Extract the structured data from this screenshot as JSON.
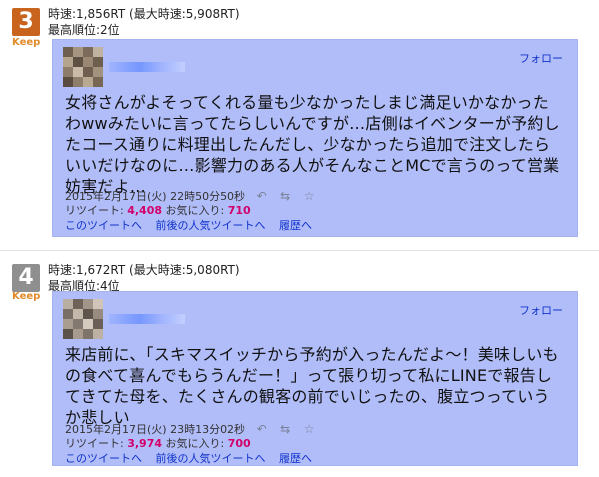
{
  "entries": [
    {
      "rank": "3",
      "keep": "Keep",
      "speed": "時速:1,856RT (最大時速:5,908RT)",
      "highest": "最高順位:2位",
      "follow": "フォロー",
      "text": "女将さんがよそってくれる量も少なかったしまじ満足いかなかったわwwみたいに言ってたらしいんですが…店側はイベンターが予約したコース通りに料理出したんだし、少なかったら追加で注文したらいいだけなのに…影響力のある人がそんなことMCで言うのって営業妨害だよ…",
      "date": "2015年2月17日(火) 22時50分50秒",
      "retweet_label": "リツイート:",
      "retweets": "4,408",
      "fav_label": "お気に入り:",
      "favs": "710",
      "link_tweet": "このツイートへ",
      "link_popular": "前後の人気ツイートへ",
      "link_history": "履歴へ"
    },
    {
      "rank": "4",
      "keep": "Keep",
      "speed": "時速:1,672RT (最大時速:5,080RT)",
      "highest": "最高順位:4位",
      "follow": "フォロー",
      "text": "来店前に、「スキマスイッチから予約が入ったんだよ～！美味しいもの食べて喜んでもらうんだー！」って張り切って私にLINEで報告してきてた母を、たくさんの観客の前でいじったの、腹立つっていうか悲しい",
      "date": "2015年2月17日(火) 23時13分02秒",
      "retweet_label": "リツイート:",
      "retweets": "3,974",
      "fav_label": "お気に入り:",
      "favs": "700",
      "link_tweet": "このツイートへ",
      "link_popular": "前後の人気ツイートへ",
      "link_history": "履歴へ"
    }
  ],
  "icons": {
    "reply": "reply-icon",
    "retweet": "retweet-icon",
    "favorite": "star-icon"
  },
  "colors": {
    "card": "#b1bdf8",
    "rank3": "#c8641e",
    "rank4": "#8f8f8f",
    "highlight": "#d2006b",
    "link": "#1133cc"
  }
}
